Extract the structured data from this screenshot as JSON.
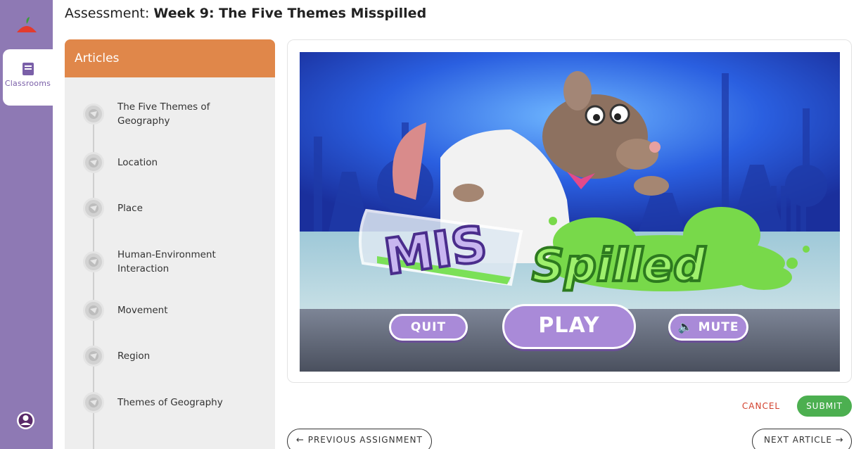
{
  "rail": {
    "tab_label": "Classrooms"
  },
  "header": {
    "prefix": "Assessment:",
    "title": "Week 9: The Five Themes Misspilled"
  },
  "articles": {
    "heading": "Articles",
    "items": [
      {
        "label": "The Five Themes of Geography"
      },
      {
        "label": "Location"
      },
      {
        "label": "Place"
      },
      {
        "label": "Human-Environment Interaction"
      },
      {
        "label": "Movement"
      },
      {
        "label": "Region"
      },
      {
        "label": "Themes of Geography"
      }
    ]
  },
  "game": {
    "logo_left": "MIS",
    "logo_right": "Spilled",
    "quit_label": "QUIT",
    "play_label": "PLAY",
    "mute_label": "MUTE"
  },
  "actions": {
    "cancel_label": "CANCEL",
    "submit_label": "SUBMIT",
    "prev_label": "PREVIOUS ASSIGNMENT",
    "next_label": "NEXT ARTICLE"
  },
  "colors": {
    "rail": "#8e79b4",
    "articles_header": "#e0874a",
    "submit": "#4caf50",
    "cancel": "#d2402c",
    "game_button": "#a98ad8"
  }
}
